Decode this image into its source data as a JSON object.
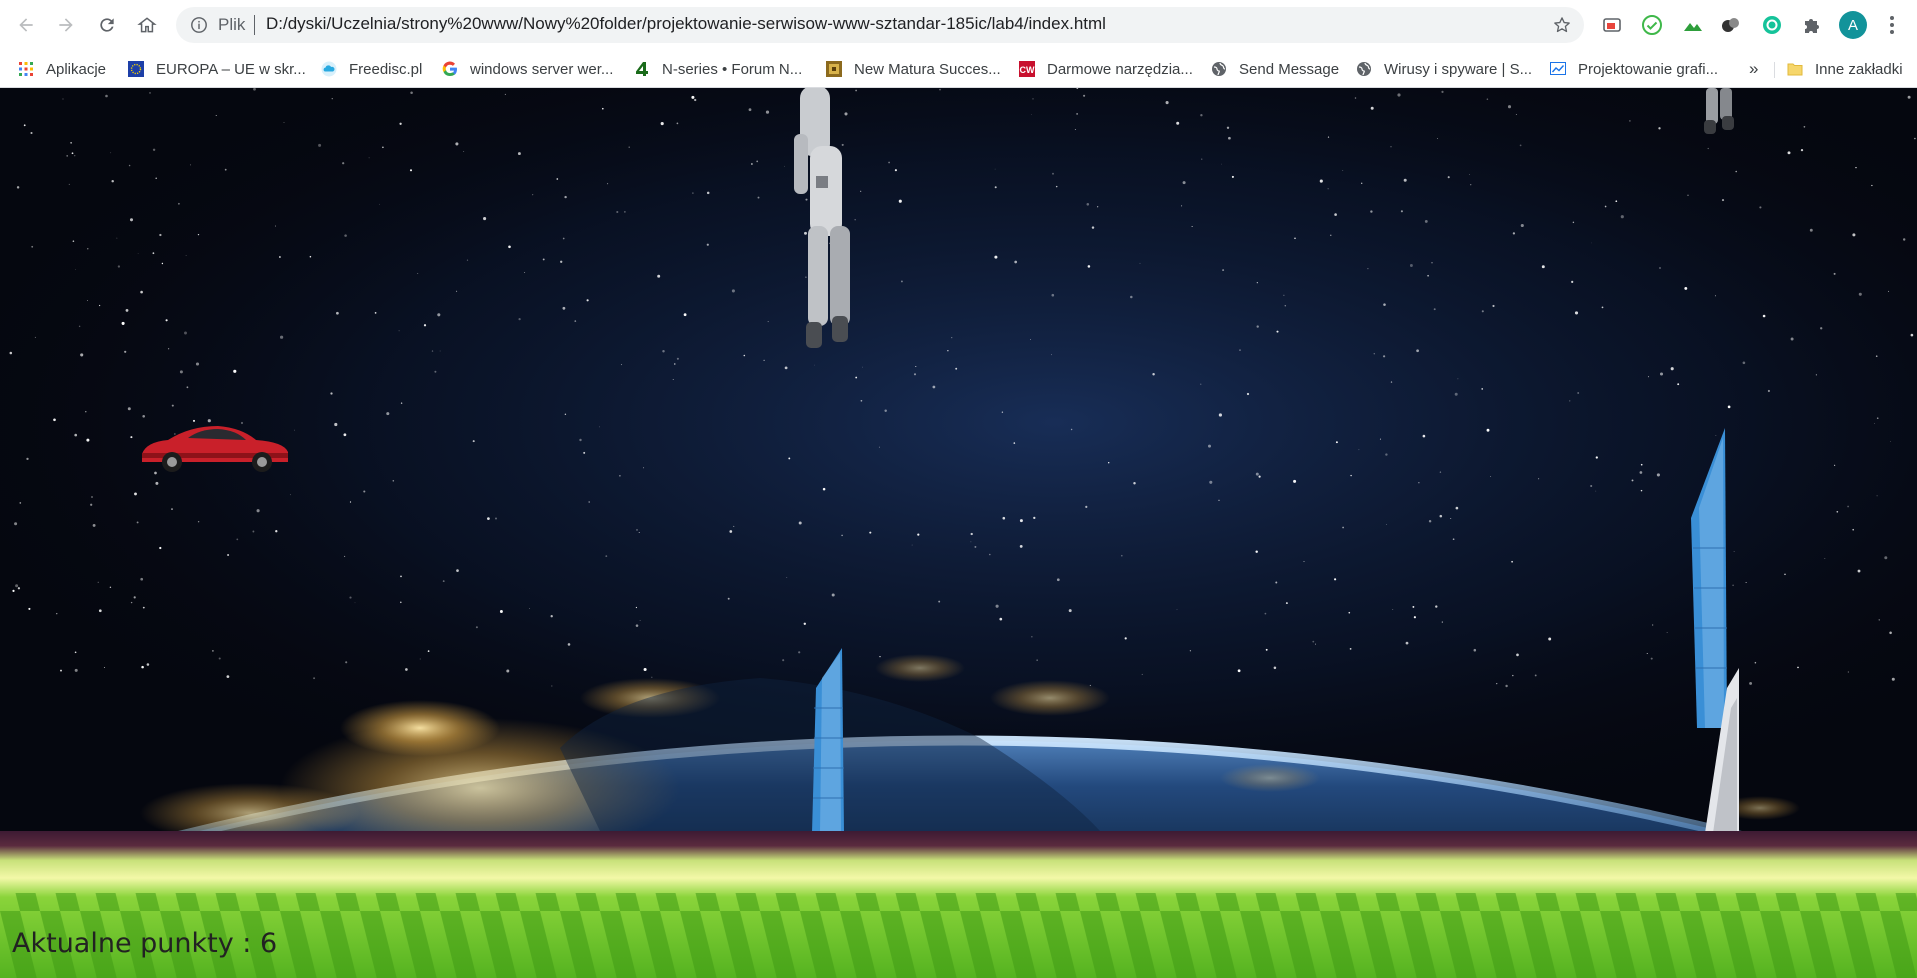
{
  "browser": {
    "scheme_label": "Plik",
    "url": "D:/dyski/Uczelnia/strony%20www/Nowy%20folder/projektowanie-serwisow-www-sztandar-185ic/lab4/index.html",
    "profile_initial": "A"
  },
  "bookmarks": {
    "items": [
      {
        "label": "Aplikacje",
        "icon": "apps-grid-icon"
      },
      {
        "label": "EUROPA – UE w skr...",
        "icon": "eu-flag-icon"
      },
      {
        "label": "Freedisc.pl",
        "icon": "cloud-icon"
      },
      {
        "label": "windows server wer...",
        "icon": "google-icon"
      },
      {
        "label": "N-series • Forum N...",
        "icon": "n-series-icon"
      },
      {
        "label": "New Matura Succes...",
        "icon": "matura-icon"
      },
      {
        "label": "Darmowe narzędzia...",
        "icon": "cw-icon"
      },
      {
        "label": "Send Message",
        "icon": "globe-icon"
      },
      {
        "label": "Wirusy i spyware | S...",
        "icon": "globe-icon"
      },
      {
        "label": "Projektowanie grafi...",
        "icon": "chart-icon"
      }
    ],
    "overflow": "»",
    "other_label": "Inne zakładki"
  },
  "game": {
    "score_label": "Aktualne punkty : 6"
  },
  "colors": {
    "space": "#05070f",
    "ground_stripe_dark": "#3d1a33",
    "ground_green": "#6fc82a",
    "ground_yellow": "#f3f8a8",
    "car_red": "#c9202a",
    "obstacle_blue": "#3a8fd6"
  }
}
